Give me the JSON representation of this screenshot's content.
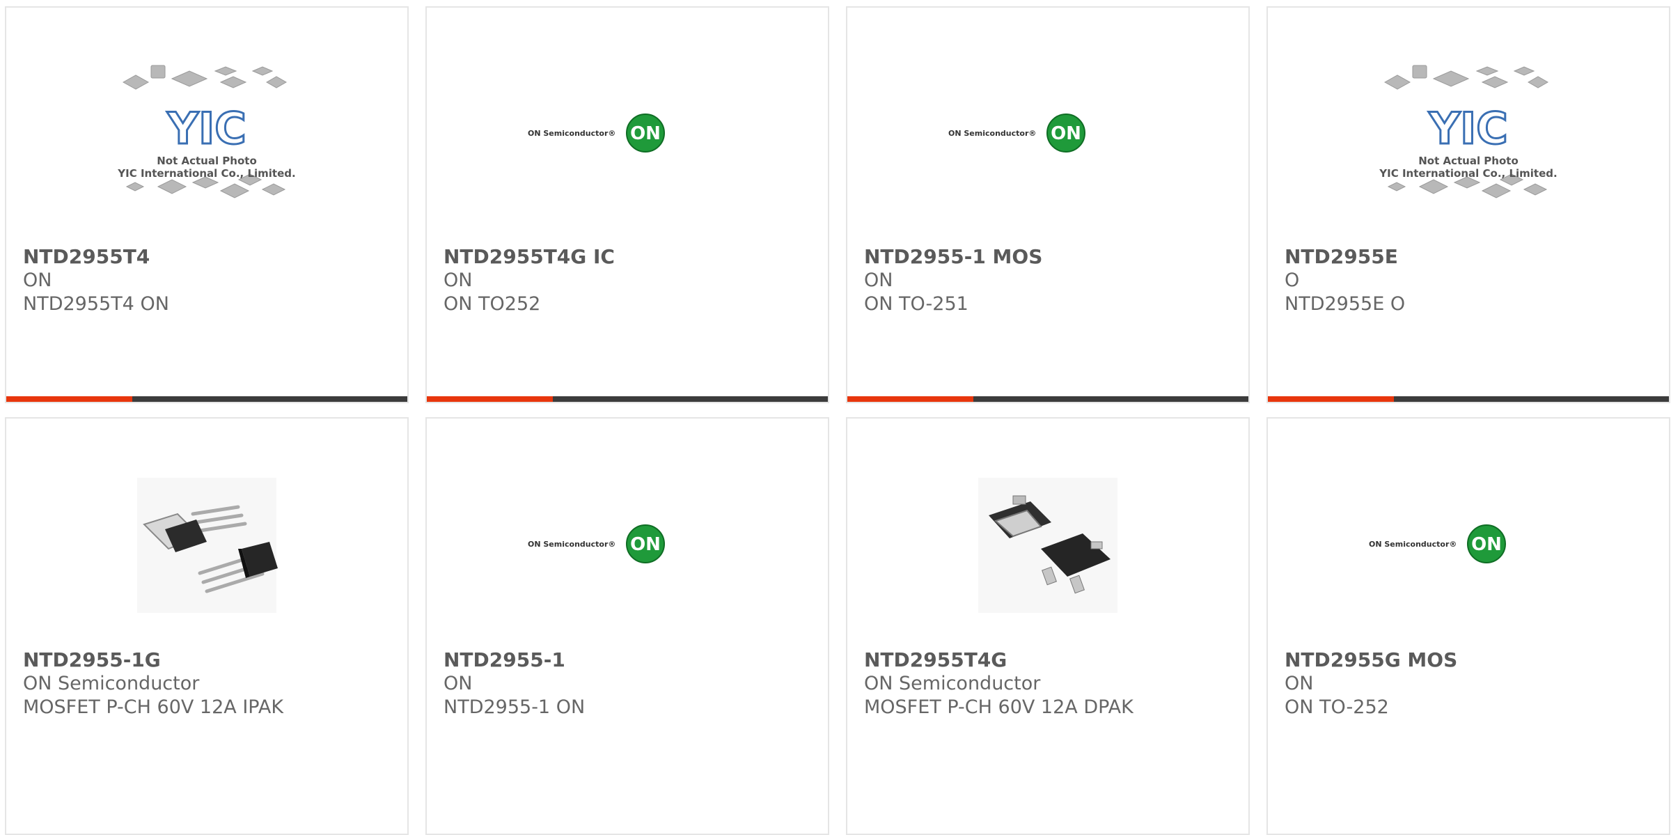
{
  "colors": {
    "border": "#e5e5e5",
    "part_number": "#5a5a5a",
    "text": "#666666",
    "bar_dark": "#3c3c3c",
    "bar_accent": "#e8360d",
    "on_logo_green": "#1f9a3a",
    "yic_blue": "#3a6fb3"
  },
  "products": [
    {
      "part_number": "NTD2955T4",
      "manufacturer": "ON",
      "description": "NTD2955T4 ON",
      "image": {
        "type": "yic-placeholder",
        "caption_line1": "Not Actual Photo",
        "caption_line2": "YIC International Co., Limited.",
        "logo_text": "YIC"
      },
      "accent_bar": true
    },
    {
      "part_number": "NTD2955T4G IC",
      "manufacturer": "ON",
      "description": "ON TO252",
      "image": {
        "type": "on-semi-logo",
        "brand_text": "ON Semiconductor®",
        "badge_text": "ON"
      },
      "accent_bar": true
    },
    {
      "part_number": "NTD2955-1 MOS",
      "manufacturer": "ON",
      "description": "ON TO-251",
      "image": {
        "type": "on-semi-logo",
        "brand_text": "ON Semiconductor®",
        "badge_text": "ON"
      },
      "accent_bar": true
    },
    {
      "part_number": "NTD2955E",
      "manufacturer": "O",
      "description": "NTD2955E O",
      "image": {
        "type": "yic-placeholder",
        "caption_line1": "Not Actual Photo",
        "caption_line2": "YIC International Co., Limited.",
        "logo_text": "YIC"
      },
      "accent_bar": true
    },
    {
      "part_number": "NTD2955-1G",
      "manufacturer": "ON Semiconductor",
      "description": "MOSFET P-CH 60V 12A IPAK",
      "image": {
        "type": "ipak-package"
      },
      "accent_bar": false
    },
    {
      "part_number": "NTD2955-1",
      "manufacturer": "ON",
      "description": "NTD2955-1 ON",
      "image": {
        "type": "on-semi-logo",
        "brand_text": "ON Semiconductor®",
        "badge_text": "ON"
      },
      "accent_bar": false
    },
    {
      "part_number": "NTD2955T4G",
      "manufacturer": "ON Semiconductor",
      "description": "MOSFET P-CH 60V 12A DPAK",
      "image": {
        "type": "dpak-package"
      },
      "accent_bar": false
    },
    {
      "part_number": "NTD2955G MOS",
      "manufacturer": "ON",
      "description": "ON TO-252",
      "image": {
        "type": "on-semi-logo",
        "brand_text": "ON Semiconductor®",
        "badge_text": "ON"
      },
      "accent_bar": false
    }
  ]
}
